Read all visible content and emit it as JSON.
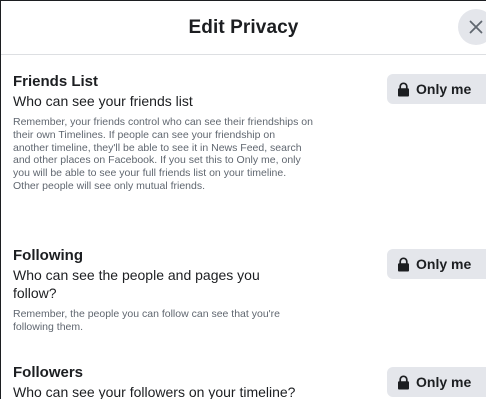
{
  "dialog": {
    "title": "Edit Privacy"
  },
  "sections": [
    {
      "title": "Friends List",
      "subtitle": "Who can see your friends list",
      "description": "Remember, your friends control who can see their friendships on their own Timelines. If people can see your friendship on another timeline, they'll be able to see it in News Feed, search and other places on Facebook. If you set this to Only me, only you will be able to see your full friends list on your timeline. Other people will see only mutual friends.",
      "button_label": "Only me"
    },
    {
      "title": "Following",
      "subtitle": "Who can see the people and pages you follow?",
      "description": "Remember, the people you can follow can see that you're following them.",
      "button_label": "Only me"
    },
    {
      "title": "Followers",
      "subtitle": "Who can see your followers on your timeline?",
      "button_label": "Only me"
    }
  ],
  "icons": {
    "close": "close-icon",
    "lock": "lock-icon"
  },
  "colors": {
    "button_bg": "#e4e6eb",
    "text": "#1c1e21",
    "secondary_text": "#606770"
  }
}
